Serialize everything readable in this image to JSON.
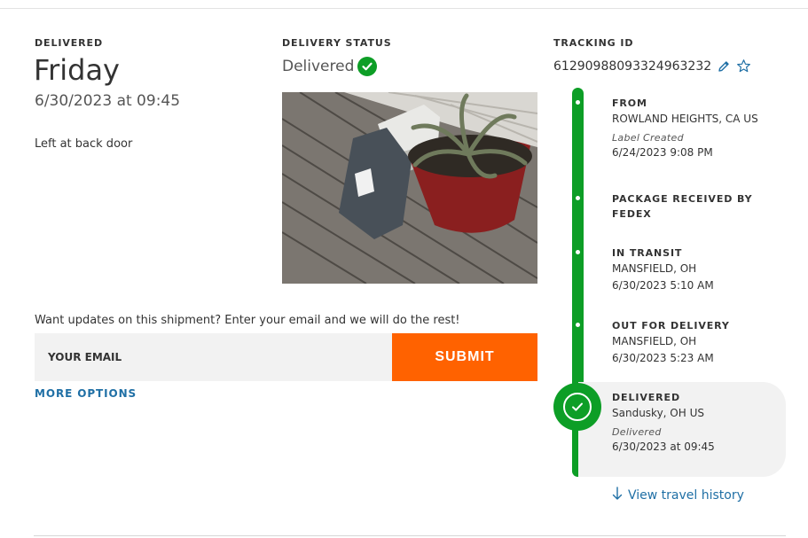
{
  "summary": {
    "delivered_label": "DELIVERED",
    "day": "Friday",
    "datetime": "6/30/2023 at 09:45",
    "note": "Left at back door"
  },
  "status": {
    "label": "DELIVERY STATUS",
    "value": "Delivered",
    "icon": "check-circle-icon",
    "color": "#0d9e26"
  },
  "tracking": {
    "label": "TRACKING ID",
    "id": "612909880933249632 32",
    "edit_icon": "pencil-icon",
    "favorite_icon": "star-icon"
  },
  "updates": {
    "prompt": "Want updates on this shipment? Enter your email and we will do the rest!",
    "email_placeholder": "YOUR EMAIL",
    "submit_label": "SUBMIT",
    "more_options": "MORE OPTIONS"
  },
  "timeline": {
    "events": [
      {
        "title": "FROM",
        "location": "ROWLAND HEIGHTS, CA US",
        "status": "Label Created",
        "time": "6/24/2023 9:08 PM"
      },
      {
        "title": "PACKAGE RECEIVED BY",
        "title2": "FEDEX"
      },
      {
        "title": "IN TRANSIT",
        "location": "MANSFIELD, OH",
        "time": "6/30/2023 5:10 AM"
      },
      {
        "title": "OUT FOR DELIVERY",
        "location": "MANSFIELD, OH",
        "time": "6/30/2023 5:23 AM"
      },
      {
        "title": "DELIVERED",
        "location": "Sandusky, OH US",
        "status": "Delivered",
        "time": "6/30/2023 at 09:45"
      }
    ],
    "view_history": "View travel history"
  },
  "colors": {
    "accent_green": "#0d9e26",
    "submit_orange": "#ff6200",
    "link_blue": "#1f6fa5"
  }
}
